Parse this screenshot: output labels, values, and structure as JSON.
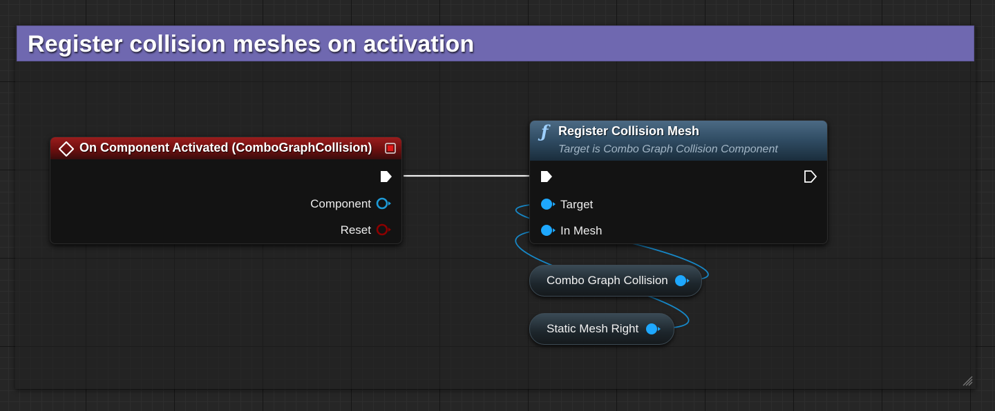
{
  "comment": {
    "title": "Register collision meshes on activation",
    "color": "#6f68b0"
  },
  "event_node": {
    "title": "On Component Activated (ComboGraphCollision)",
    "icon": "event-diamond-icon",
    "header_color": "#8b1a1a",
    "output_pins": [
      {
        "label": "Component",
        "type": "object",
        "color": "#1e9bd8"
      },
      {
        "label": "Reset",
        "type": "bool",
        "color": "#8c0000"
      }
    ]
  },
  "function_node": {
    "title": "Register Collision Mesh",
    "subtitle": "Target is Combo Graph Collision Component",
    "icon": "function-icon",
    "header_color": "#2f4b62",
    "input_pins": [
      {
        "label": "Target",
        "type": "object",
        "color": "#1ea8ff"
      },
      {
        "label": "In Mesh",
        "type": "object",
        "color": "#1ea8ff"
      }
    ]
  },
  "variable_nodes": [
    {
      "label": "Combo Graph Collision",
      "color": "#1ea8ff"
    },
    {
      "label": "Static Mesh Right",
      "color": "#1ea8ff"
    }
  ]
}
